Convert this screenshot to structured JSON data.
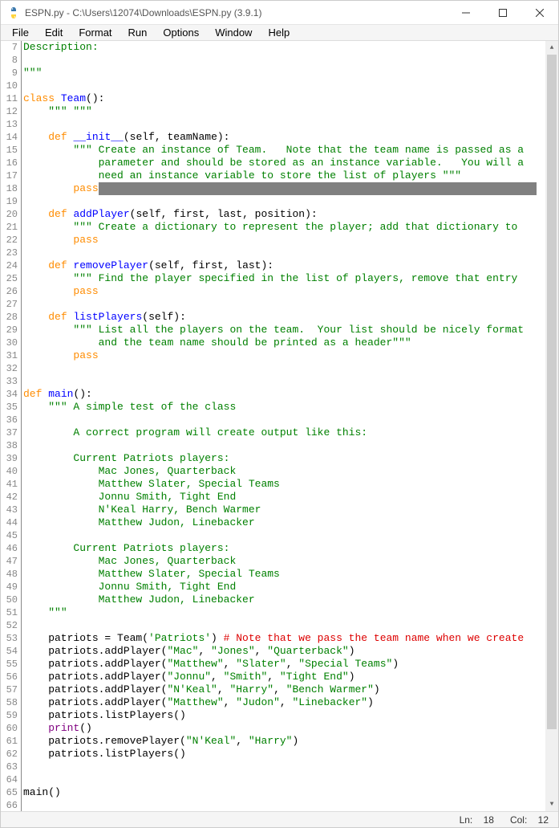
{
  "window": {
    "title": "ESPN.py - C:\\Users\\12074\\Downloads\\ESPN.py (3.9.1)"
  },
  "menubar": {
    "items": [
      "File",
      "Edit",
      "Format",
      "Run",
      "Options",
      "Window",
      "Help"
    ]
  },
  "status": {
    "ln_label": "Ln:",
    "ln": "18",
    "col_label": "Col:",
    "col": "12"
  },
  "gutter_start": 7,
  "gutter_end": 66,
  "code_lines": [
    {
      "n": 7,
      "spans": [
        {
          "c": "str",
          "t": "Description:"
        }
      ]
    },
    {
      "n": 8,
      "spans": []
    },
    {
      "n": 9,
      "spans": [
        {
          "c": "str",
          "t": "\"\"\""
        }
      ]
    },
    {
      "n": 10,
      "spans": []
    },
    {
      "n": 11,
      "spans": [
        {
          "c": "kw",
          "t": "class"
        },
        {
          "t": " "
        },
        {
          "c": "defname",
          "t": "Team"
        },
        {
          "t": "():"
        }
      ]
    },
    {
      "n": 12,
      "spans": [
        {
          "t": "    "
        },
        {
          "c": "str",
          "t": "\"\"\" \"\"\""
        }
      ]
    },
    {
      "n": 13,
      "spans": []
    },
    {
      "n": 14,
      "spans": [
        {
          "t": "    "
        },
        {
          "c": "kw",
          "t": "def"
        },
        {
          "t": " "
        },
        {
          "c": "defname",
          "t": "__init__"
        },
        {
          "t": "(self, teamName):"
        }
      ]
    },
    {
      "n": 15,
      "spans": [
        {
          "t": "        "
        },
        {
          "c": "str",
          "t": "\"\"\" Create an instance of Team.   Note that the team name is passed as a"
        }
      ]
    },
    {
      "n": 16,
      "spans": [
        {
          "t": "            "
        },
        {
          "c": "str",
          "t": "parameter and should be stored as an instance variable.   You will a"
        }
      ]
    },
    {
      "n": 17,
      "spans": [
        {
          "t": "            "
        },
        {
          "c": "str",
          "t": "need an instance variable to store the list of players \"\"\""
        }
      ]
    },
    {
      "n": 18,
      "spans": [
        {
          "t": "        "
        },
        {
          "c": "kw",
          "t": "pass"
        },
        {
          "c": "hl",
          "t": "                                                                      "
        }
      ]
    },
    {
      "n": 19,
      "spans": []
    },
    {
      "n": 20,
      "spans": [
        {
          "t": "    "
        },
        {
          "c": "kw",
          "t": "def"
        },
        {
          "t": " "
        },
        {
          "c": "defname",
          "t": "addPlayer"
        },
        {
          "t": "(self, first, last, position):"
        }
      ]
    },
    {
      "n": 21,
      "spans": [
        {
          "t": "        "
        },
        {
          "c": "str",
          "t": "\"\"\" Create a dictionary to represent the player; add that dictionary to"
        }
      ]
    },
    {
      "n": 22,
      "spans": [
        {
          "t": "        "
        },
        {
          "c": "kw",
          "t": "pass"
        }
      ]
    },
    {
      "n": 23,
      "spans": []
    },
    {
      "n": 24,
      "spans": [
        {
          "t": "    "
        },
        {
          "c": "kw",
          "t": "def"
        },
        {
          "t": " "
        },
        {
          "c": "defname",
          "t": "removePlayer"
        },
        {
          "t": "(self, first, last):"
        }
      ]
    },
    {
      "n": 25,
      "spans": [
        {
          "t": "        "
        },
        {
          "c": "str",
          "t": "\"\"\" Find the player specified in the list of players, remove that entry"
        }
      ]
    },
    {
      "n": 26,
      "spans": [
        {
          "t": "        "
        },
        {
          "c": "kw",
          "t": "pass"
        }
      ]
    },
    {
      "n": 27,
      "spans": []
    },
    {
      "n": 28,
      "spans": [
        {
          "t": "    "
        },
        {
          "c": "kw",
          "t": "def"
        },
        {
          "t": " "
        },
        {
          "c": "defname",
          "t": "listPlayers"
        },
        {
          "t": "(self):"
        }
      ]
    },
    {
      "n": 29,
      "spans": [
        {
          "t": "        "
        },
        {
          "c": "str",
          "t": "\"\"\" List all the players on the team.  Your list should be nicely format"
        }
      ]
    },
    {
      "n": 30,
      "spans": [
        {
          "t": "            "
        },
        {
          "c": "str",
          "t": "and the team name should be printed as a header\"\"\""
        }
      ]
    },
    {
      "n": 31,
      "spans": [
        {
          "t": "        "
        },
        {
          "c": "kw",
          "t": "pass"
        }
      ]
    },
    {
      "n": 32,
      "spans": []
    },
    {
      "n": 33,
      "spans": []
    },
    {
      "n": 34,
      "spans": [
        {
          "c": "kw",
          "t": "def"
        },
        {
          "t": " "
        },
        {
          "c": "defname",
          "t": "main"
        },
        {
          "t": "():"
        }
      ]
    },
    {
      "n": 35,
      "spans": [
        {
          "t": "    "
        },
        {
          "c": "str",
          "t": "\"\"\" A simple test of the class"
        }
      ]
    },
    {
      "n": 36,
      "spans": []
    },
    {
      "n": 37,
      "spans": [
        {
          "t": "        "
        },
        {
          "c": "str",
          "t": "A correct program will create output like this:"
        }
      ]
    },
    {
      "n": 38,
      "spans": []
    },
    {
      "n": 39,
      "spans": [
        {
          "t": "        "
        },
        {
          "c": "str",
          "t": "Current Patriots players:"
        }
      ]
    },
    {
      "n": 40,
      "spans": [
        {
          "t": "            "
        },
        {
          "c": "str",
          "t": "Mac Jones, Quarterback"
        }
      ]
    },
    {
      "n": 41,
      "spans": [
        {
          "t": "            "
        },
        {
          "c": "str",
          "t": "Matthew Slater, Special Teams"
        }
      ]
    },
    {
      "n": 42,
      "spans": [
        {
          "t": "            "
        },
        {
          "c": "str",
          "t": "Jonnu Smith, Tight End"
        }
      ]
    },
    {
      "n": 43,
      "spans": [
        {
          "t": "            "
        },
        {
          "c": "str",
          "t": "N'Keal Harry, Bench Warmer"
        }
      ]
    },
    {
      "n": 44,
      "spans": [
        {
          "t": "            "
        },
        {
          "c": "str",
          "t": "Matthew Judon, Linebacker"
        }
      ]
    },
    {
      "n": 45,
      "spans": []
    },
    {
      "n": 46,
      "spans": [
        {
          "t": "        "
        },
        {
          "c": "str",
          "t": "Current Patriots players:"
        }
      ]
    },
    {
      "n": 47,
      "spans": [
        {
          "t": "            "
        },
        {
          "c": "str",
          "t": "Mac Jones, Quarterback"
        }
      ]
    },
    {
      "n": 48,
      "spans": [
        {
          "t": "            "
        },
        {
          "c": "str",
          "t": "Matthew Slater, Special Teams"
        }
      ]
    },
    {
      "n": 49,
      "spans": [
        {
          "t": "            "
        },
        {
          "c": "str",
          "t": "Jonnu Smith, Tight End"
        }
      ]
    },
    {
      "n": 50,
      "spans": [
        {
          "t": "            "
        },
        {
          "c": "str",
          "t": "Matthew Judon, Linebacker"
        }
      ]
    },
    {
      "n": 51,
      "spans": [
        {
          "t": "    "
        },
        {
          "c": "str",
          "t": "\"\"\""
        }
      ]
    },
    {
      "n": 52,
      "spans": []
    },
    {
      "n": 53,
      "spans": [
        {
          "t": "    patriots = Team("
        },
        {
          "c": "str",
          "t": "'Patriots'"
        },
        {
          "t": ") "
        },
        {
          "c": "comment",
          "t": "# Note that we pass the team name when we create"
        }
      ]
    },
    {
      "n": 54,
      "spans": [
        {
          "t": "    patriots.addPlayer("
        },
        {
          "c": "str",
          "t": "\"Mac\""
        },
        {
          "t": ", "
        },
        {
          "c": "str",
          "t": "\"Jones\""
        },
        {
          "t": ", "
        },
        {
          "c": "str",
          "t": "\"Quarterback\""
        },
        {
          "t": ")"
        }
      ]
    },
    {
      "n": 55,
      "spans": [
        {
          "t": "    patriots.addPlayer("
        },
        {
          "c": "str",
          "t": "\"Matthew\""
        },
        {
          "t": ", "
        },
        {
          "c": "str",
          "t": "\"Slater\""
        },
        {
          "t": ", "
        },
        {
          "c": "str",
          "t": "\"Special Teams\""
        },
        {
          "t": ")"
        }
      ]
    },
    {
      "n": 56,
      "spans": [
        {
          "t": "    patriots.addPlayer("
        },
        {
          "c": "str",
          "t": "\"Jonnu\""
        },
        {
          "t": ", "
        },
        {
          "c": "str",
          "t": "\"Smith\""
        },
        {
          "t": ", "
        },
        {
          "c": "str",
          "t": "\"Tight End\""
        },
        {
          "t": ")"
        }
      ]
    },
    {
      "n": 57,
      "spans": [
        {
          "t": "    patriots.addPlayer("
        },
        {
          "c": "str",
          "t": "\"N'Keal\""
        },
        {
          "t": ", "
        },
        {
          "c": "str",
          "t": "\"Harry\""
        },
        {
          "t": ", "
        },
        {
          "c": "str",
          "t": "\"Bench Warmer\""
        },
        {
          "t": ")"
        }
      ]
    },
    {
      "n": 58,
      "spans": [
        {
          "t": "    patriots.addPlayer("
        },
        {
          "c": "str",
          "t": "\"Matthew\""
        },
        {
          "t": ", "
        },
        {
          "c": "str",
          "t": "\"Judon\""
        },
        {
          "t": ", "
        },
        {
          "c": "str",
          "t": "\"Linebacker\""
        },
        {
          "t": ")"
        }
      ]
    },
    {
      "n": 59,
      "spans": [
        {
          "t": "    patriots.listPlayers()"
        }
      ]
    },
    {
      "n": 60,
      "spans": [
        {
          "t": "    "
        },
        {
          "c": "builtin",
          "t": "print"
        },
        {
          "t": "()"
        }
      ]
    },
    {
      "n": 61,
      "spans": [
        {
          "t": "    patriots.removePlayer("
        },
        {
          "c": "str",
          "t": "\"N'Keal\""
        },
        {
          "t": ", "
        },
        {
          "c": "str",
          "t": "\"Harry\""
        },
        {
          "t": ")"
        }
      ]
    },
    {
      "n": 62,
      "spans": [
        {
          "t": "    patriots.listPlayers()"
        }
      ]
    },
    {
      "n": 63,
      "spans": []
    },
    {
      "n": 64,
      "spans": []
    },
    {
      "n": 65,
      "spans": [
        {
          "t": "main()"
        }
      ]
    },
    {
      "n": 66,
      "spans": []
    }
  ]
}
